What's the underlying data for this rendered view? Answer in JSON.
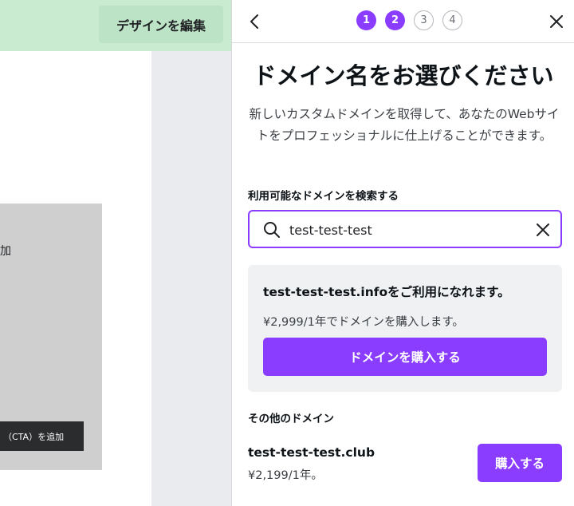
{
  "editor": {
    "edit_design_label": "デザインを編集",
    "add_text_fragment": "加",
    "cta_tooltip": "（CTA）を追加"
  },
  "panel": {
    "steps": [
      "1",
      "2",
      "3",
      "4"
    ],
    "active_steps": [
      1,
      2
    ],
    "title": "ドメイン名をお選びください",
    "description": "新しいカスタムドメインを取得して、あなたのWebサイトをプロフェッショナルに仕上げることができます。",
    "search_label": "利用可能なドメインを検索する",
    "search_value": "test-test-test",
    "featured": {
      "availability_msg": "test-test-test.infoをご利用になれます。",
      "price_msg": "¥2,999/1年でドメインを購入します。",
      "buy_label": "ドメインを購入する"
    },
    "other_label": "その他のドメイン",
    "other_domains": [
      {
        "domain": "test-test-test.club",
        "price": "¥2,199/1年。",
        "buy_label": "購入する"
      }
    ]
  },
  "colors": {
    "accent": "#8b3dff",
    "header_green": "#c9ecd1",
    "card_bg": "#f0f1f3"
  },
  "icons": [
    "chevron-left-icon",
    "close-icon",
    "search-icon",
    "clear-icon"
  ]
}
